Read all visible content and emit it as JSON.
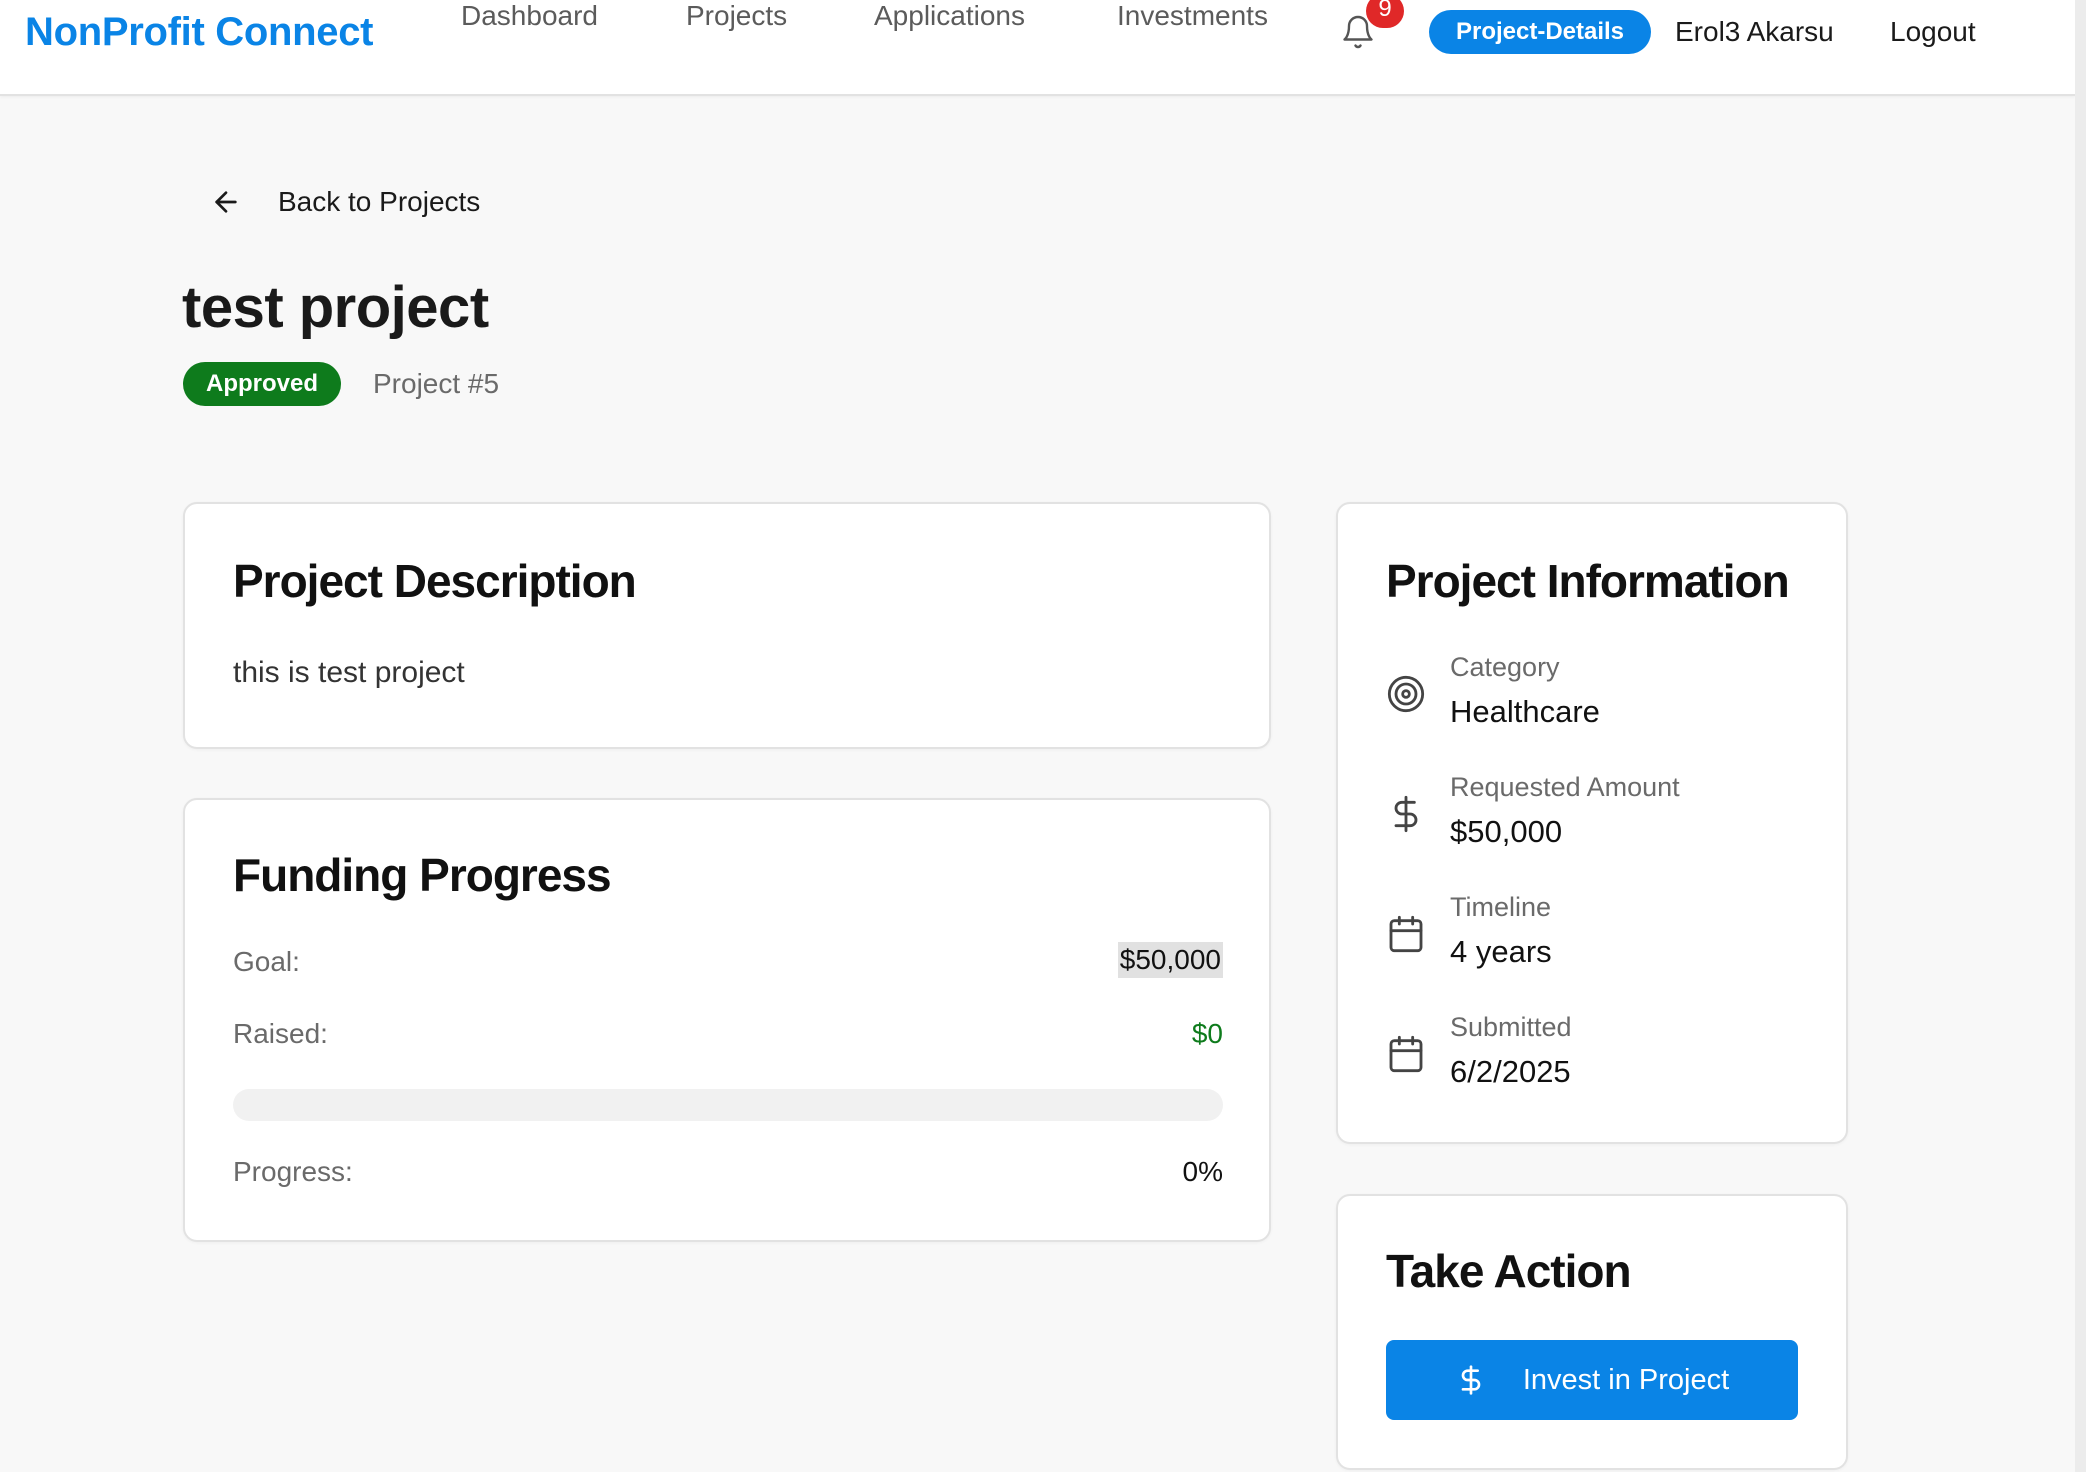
{
  "nav": {
    "brand": "NonProfit Connect",
    "links": [
      "Dashboard",
      "Projects",
      "Applications",
      "Investments"
    ],
    "notification_count": "9",
    "active_page": "Project-Details",
    "user_name": "Erol3 Akarsu",
    "logout": "Logout",
    "bell_icon": "bell-icon"
  },
  "header": {
    "back_label": "Back to Projects",
    "back_icon": "arrow-left-icon",
    "title": "test project",
    "status": "Approved",
    "project_number": "Project #5"
  },
  "description": {
    "title": "Project Description",
    "text": "this is test project"
  },
  "funding": {
    "title": "Funding Progress",
    "goal_label": "Goal:",
    "goal_value": "$50,000",
    "raised_label": "Raised:",
    "raised_value": "$0",
    "progress_label": "Progress:",
    "progress_value": "0%",
    "progress_fraction": 0
  },
  "info": {
    "title": "Project Information",
    "items": [
      {
        "label": "Category",
        "value": "Healthcare",
        "icon": "target-icon"
      },
      {
        "label": "Requested Amount",
        "value": "$50,000",
        "icon": "dollar-icon"
      },
      {
        "label": "Timeline",
        "value": "4 years",
        "icon": "calendar-icon"
      },
      {
        "label": "Submitted",
        "value": "6/2/2025",
        "icon": "calendar-icon"
      }
    ]
  },
  "action": {
    "title": "Take Action",
    "invest_label": "Invest in Project",
    "invest_icon": "dollar-icon"
  },
  "colors": {
    "brand_blue": "#0a84e6",
    "approved_green": "#0e7b1c",
    "badge_red": "#e02828",
    "background": "#f8f8f8"
  }
}
